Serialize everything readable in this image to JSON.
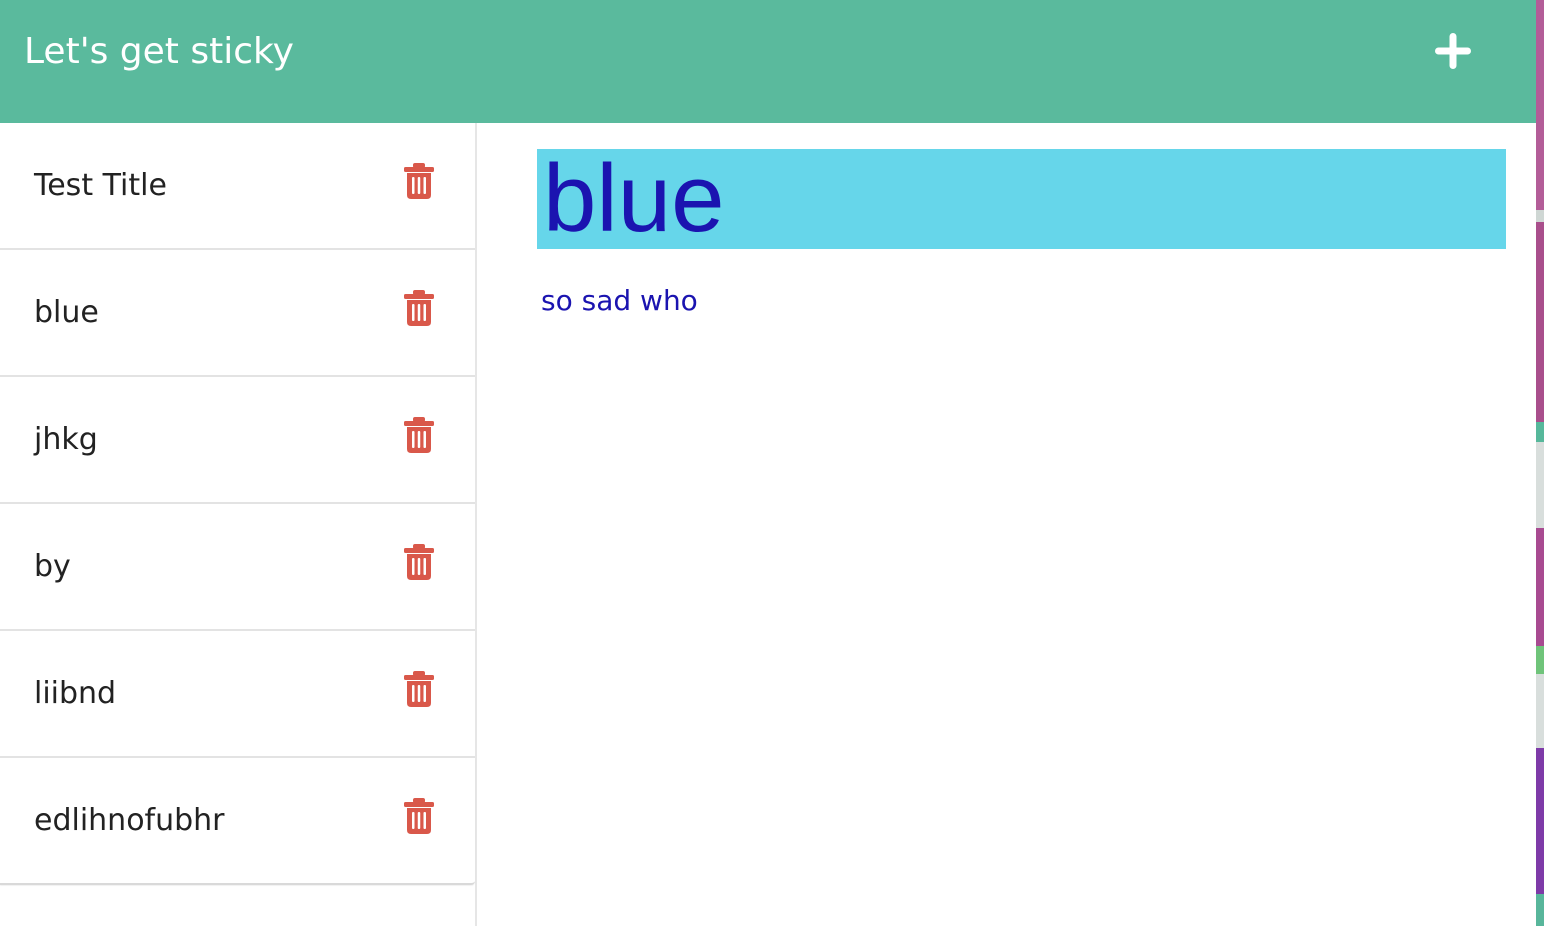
{
  "header": {
    "title": "Let's get sticky",
    "add_icon": "plus-icon"
  },
  "sidebar": {
    "notes": [
      {
        "title": "Test Title",
        "delete_icon": "trash-icon"
      },
      {
        "title": "blue",
        "delete_icon": "trash-icon"
      },
      {
        "title": "jhkg",
        "delete_icon": "trash-icon"
      },
      {
        "title": "by",
        "delete_icon": "trash-icon"
      },
      {
        "title": "liibnd",
        "delete_icon": "trash-icon"
      },
      {
        "title": "edlihnofubhr",
        "delete_icon": "trash-icon"
      }
    ]
  },
  "editor": {
    "title_value": "blue",
    "body_text": "so sad who"
  },
  "colors": {
    "header_background": "#5aba9d",
    "header_text": "#ffffff",
    "delete_icon": "#d9584a",
    "title_highlight": "#66d6ea",
    "note_text": "#1b14b0",
    "list_text": "#222222"
  }
}
